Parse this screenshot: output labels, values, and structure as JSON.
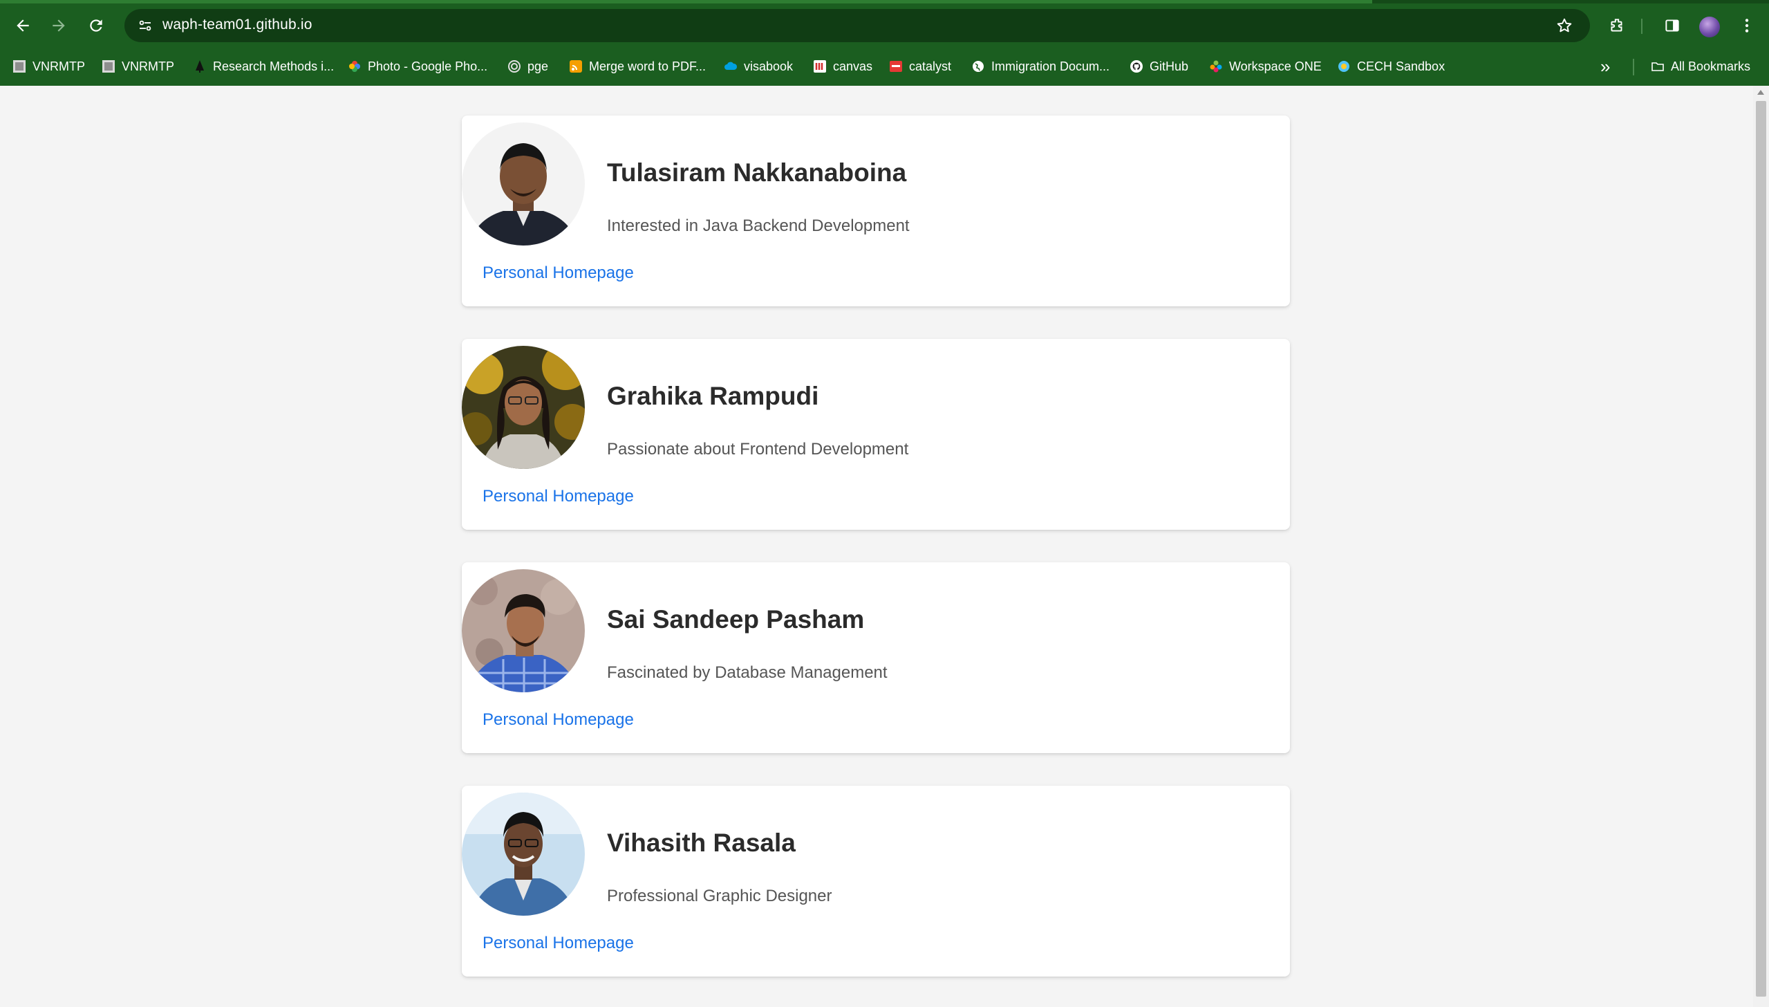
{
  "browser": {
    "url": "waph-team01.github.io",
    "bookmarks": [
      {
        "label": "VNRMTP",
        "icon": "image-icon"
      },
      {
        "label": "VNRMTP",
        "icon": "image-icon"
      },
      {
        "label": "Research Methods i...",
        "icon": "tree-icon"
      },
      {
        "label": "Photo - Google Pho...",
        "icon": "pinwheel-icon"
      },
      {
        "label": "pge",
        "icon": "swirl-icon"
      },
      {
        "label": "Merge word to PDF...",
        "icon": "rss-icon"
      },
      {
        "label": "visabook",
        "icon": "cloud-icon"
      },
      {
        "label": "canvas",
        "icon": "canvas-icon"
      },
      {
        "label": "catalyst",
        "icon": "catalyst-icon"
      },
      {
        "label": "Immigration Docum...",
        "icon": "globe-icon"
      },
      {
        "label": "GitHub",
        "icon": "github-icon"
      },
      {
        "label": "Workspace ONE",
        "icon": "workspace-icon"
      },
      {
        "label": "CECH Sandbox",
        "icon": "globe-icon"
      }
    ],
    "all_bookmarks": "All Bookmarks"
  },
  "team": [
    {
      "name": "Tulasiram Nakkanaboina",
      "bio": "Interested in Java Backend Development",
      "link": "Personal Homepage"
    },
    {
      "name": "Grahika Rampudi",
      "bio": "Passionate about Frontend Development",
      "link": "Personal Homepage"
    },
    {
      "name": "Sai Sandeep Pasham",
      "bio": "Fascinated by Database Management",
      "link": "Personal Homepage"
    },
    {
      "name": "Vihasith Rasala",
      "bio": "Professional Graphic Designer",
      "link": "Personal Homepage"
    }
  ],
  "colors": {
    "chrome": "#1b5e20",
    "link": "#1a73e8"
  }
}
